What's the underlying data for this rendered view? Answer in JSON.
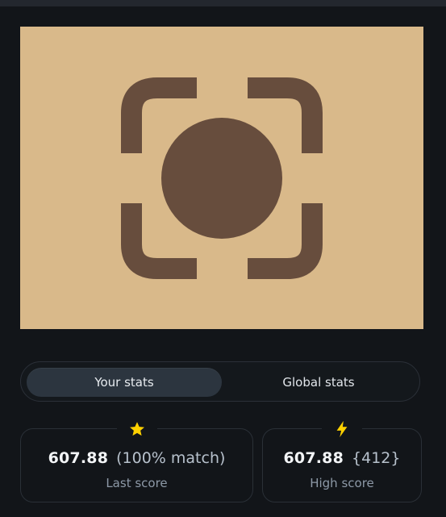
{
  "hero": {
    "icon": "camera-focus-icon",
    "colors": {
      "background": "#d9b98a",
      "foreground": "#674d3d"
    }
  },
  "tabs": [
    {
      "label": "Your stats",
      "active": true
    },
    {
      "label": "Global stats",
      "active": false
    }
  ],
  "stats": {
    "last": {
      "icon": "star-icon",
      "icon_color": "#ffd100",
      "score": "607.88",
      "extra": "(100% match)",
      "label": "Last score"
    },
    "high": {
      "icon": "lightning-icon",
      "icon_color": "#ffd100",
      "score": "607.88",
      "extra": "{412}",
      "label": "High score"
    }
  }
}
